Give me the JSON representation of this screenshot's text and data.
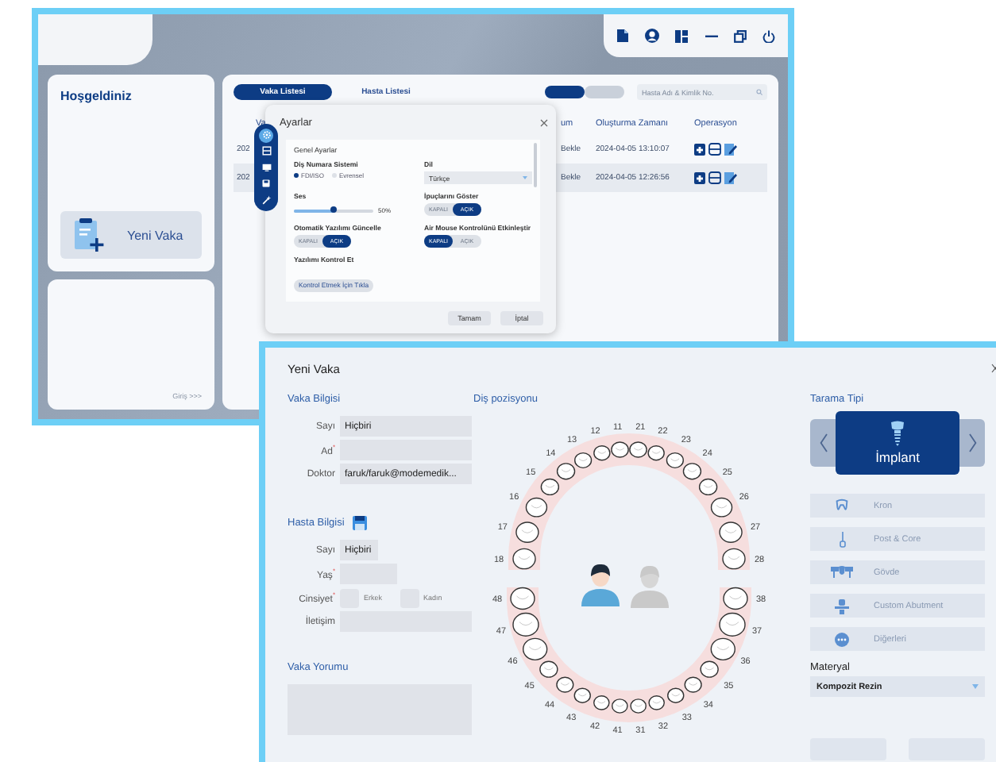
{
  "back_window": {
    "welcome": {
      "title": "Hoşgeldiniz",
      "new_case_button": "Yeni Vaka"
    },
    "login_card": {
      "link": "Giriş >>>"
    },
    "tabs": [
      {
        "label": "Vaka Listesi",
        "selected": true
      },
      {
        "label": "Hasta Listesi",
        "selected": false
      }
    ],
    "mode_toggle": [
      {
        "selected": true
      },
      {
        "selected": false
      }
    ],
    "search": {
      "placeholder": "Hasta Adı & Kimlik No."
    },
    "table": {
      "columns": [
        "Va",
        "um",
        "Oluşturma Zamanı",
        "Operasyon"
      ],
      "rows": [
        {
          "cells": [
            "202",
            "Bekle",
            "2024-04-05 13:10:07"
          ],
          "selected": false
        },
        {
          "cells": [
            "202",
            "Bekle",
            "2024-04-05 12:26:56"
          ],
          "selected": true
        }
      ]
    },
    "settings_dialog": {
      "title": "Ayarlar",
      "nav": [
        {
          "kind": "gear",
          "selected": true
        },
        {
          "kind": "scan",
          "selected": false
        },
        {
          "kind": "monitor",
          "selected": false
        },
        {
          "kind": "disk",
          "selected": false
        },
        {
          "kind": "wand",
          "selected": false
        }
      ],
      "section": "Genel Ayarlar",
      "numbering": {
        "label": "Diş Numara Sistemi",
        "options": [
          {
            "label": "FDI/ISO",
            "selected": true
          },
          {
            "label": "Evrensel",
            "selected": false
          }
        ]
      },
      "language": {
        "label": "Dil",
        "value": "Türkçe"
      },
      "volume": {
        "label": "Ses",
        "level": 0.5,
        "reading": "50%"
      },
      "toggles": [
        {
          "label": "İpuçlarını Göster",
          "options": [
            {
              "label": "KAPALI",
              "selected": false
            },
            {
              "label": "AÇIK",
              "selected": true
            }
          ]
        },
        {
          "label": "Otomatik Yazılımı Güncelle",
          "options": [
            {
              "label": "KAPALI",
              "selected": false
            },
            {
              "label": "AÇIK",
              "selected": true
            }
          ]
        },
        {
          "label": "Air Mouse Kontrolünü Etkinleştir",
          "options": [
            {
              "label": "KAPALI",
              "selected": true
            },
            {
              "label": "AÇIK",
              "selected": false
            }
          ]
        }
      ],
      "check": {
        "label": "Yazılımı Kontrol Et",
        "button": "Kontrol Etmek İçin Tıkla"
      },
      "buttons": [
        "Tamam",
        "İptal"
      ]
    }
  },
  "front_window": {
    "title": "Yeni Vaka",
    "case_info": {
      "title": "Vaka Bilgisi",
      "fields": [
        {
          "label": "Sayı",
          "value": "Hiçbiri"
        },
        {
          "label": "Ad$^{*}$"
        },
        {
          "label": "Doktor",
          "value": "faruk/faruk@modemedik..."
        }
      ]
    },
    "patient_info": {
      "title": "Hasta Bilgisi",
      "fields": [
        {
          "kind": "short",
          "label": "Sayı",
          "value": "Hiçbiri"
        },
        {
          "kind": "short",
          "label": "Yaş$^{*}$"
        },
        {
          "kind": "gender",
          "label": "Cinsiyet$^{*}$",
          "options": [
            {
              "label": "Erkek",
              "checked": false
            },
            {
              "label": "Kadın",
              "checked": false
            }
          ]
        },
        {
          "kind": "text",
          "label": "İletişim"
        }
      ]
    },
    "comment": {
      "title": "Vaka Yorumu"
    },
    "tooth_chart": {
      "title": "Diş pozisyonu",
      "upper": [
        "18",
        "17",
        "16",
        "15",
        "14",
        "13",
        "12",
        "11",
        "21",
        "22",
        "23",
        "24",
        "25",
        "26",
        "27",
        "28"
      ],
      "lower": [
        "48",
        "47",
        "46",
        "45",
        "44",
        "43",
        "42",
        "41",
        "31",
        "32",
        "33",
        "34",
        "35",
        "36",
        "37",
        "38"
      ],
      "figures": [
        {
          "selected": true
        },
        {
          "selected": false
        }
      ]
    },
    "scan_type": {
      "title": "Tarama Tipi",
      "current": "İmplant",
      "options": [
        {
          "kind": "crown",
          "label": "Kron"
        },
        {
          "kind": "post",
          "label": "Post & Core"
        },
        {
          "kind": "bridge",
          "label": "Gövde"
        },
        {
          "kind": "abutment",
          "label": "Custom Abutment"
        },
        {
          "kind": "more",
          "label": "Diğerleri"
        }
      ]
    },
    "material": {
      "label": "Materyal",
      "value": "Kompozit Rezin"
    }
  }
}
